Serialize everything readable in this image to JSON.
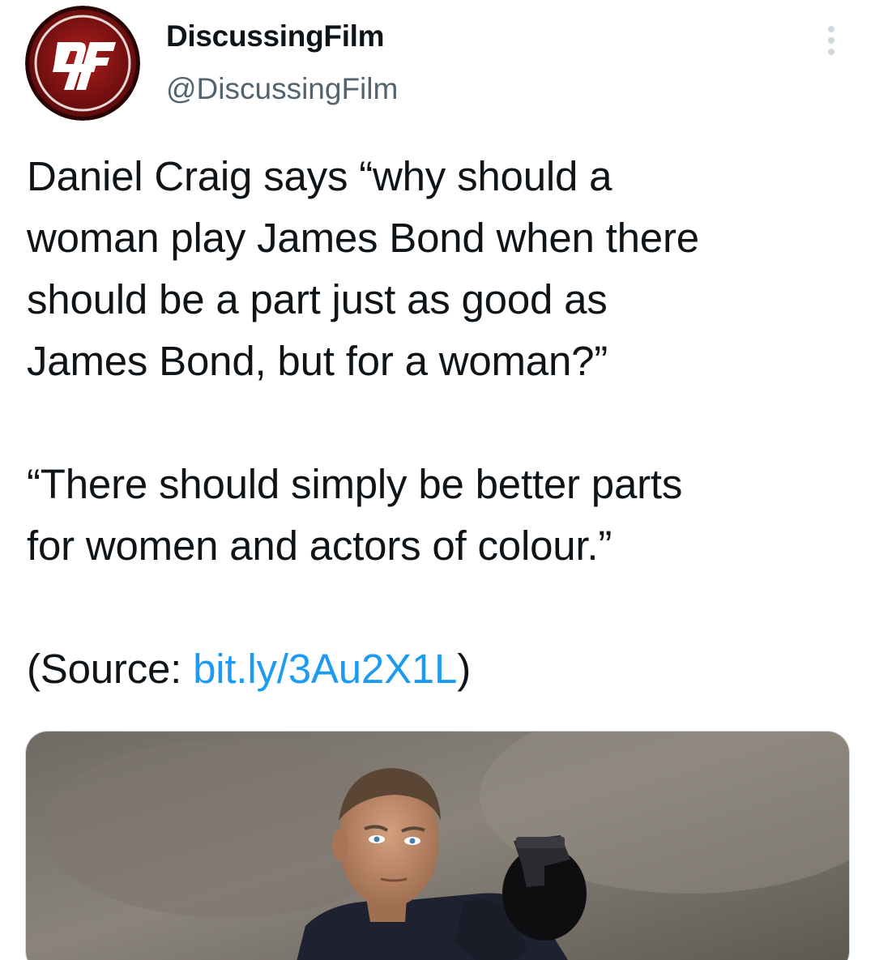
{
  "author": {
    "display_name": "DiscussingFilm",
    "handle": "@DiscussingFilm",
    "avatar_icon": "discussingfilm-logo-icon",
    "brand_color": "#8b1414"
  },
  "header": {
    "more_icon": "more-vertical-icon"
  },
  "tweet": {
    "line1": "Daniel Craig says “why should a",
    "line2": "woman play James Bond when there",
    "line3": "should be a part just as good as",
    "line4": "James Bond, but for a woman?”",
    "line5": "“There should simply be better parts",
    "line6": "for women and actors of colour.”",
    "source_prefix": "(Source: ",
    "source_link": "bit.ly/3Au2X1L",
    "source_suffix": ")",
    "link_color": "#1d9bf0"
  },
  "media": {
    "type": "photo"
  }
}
